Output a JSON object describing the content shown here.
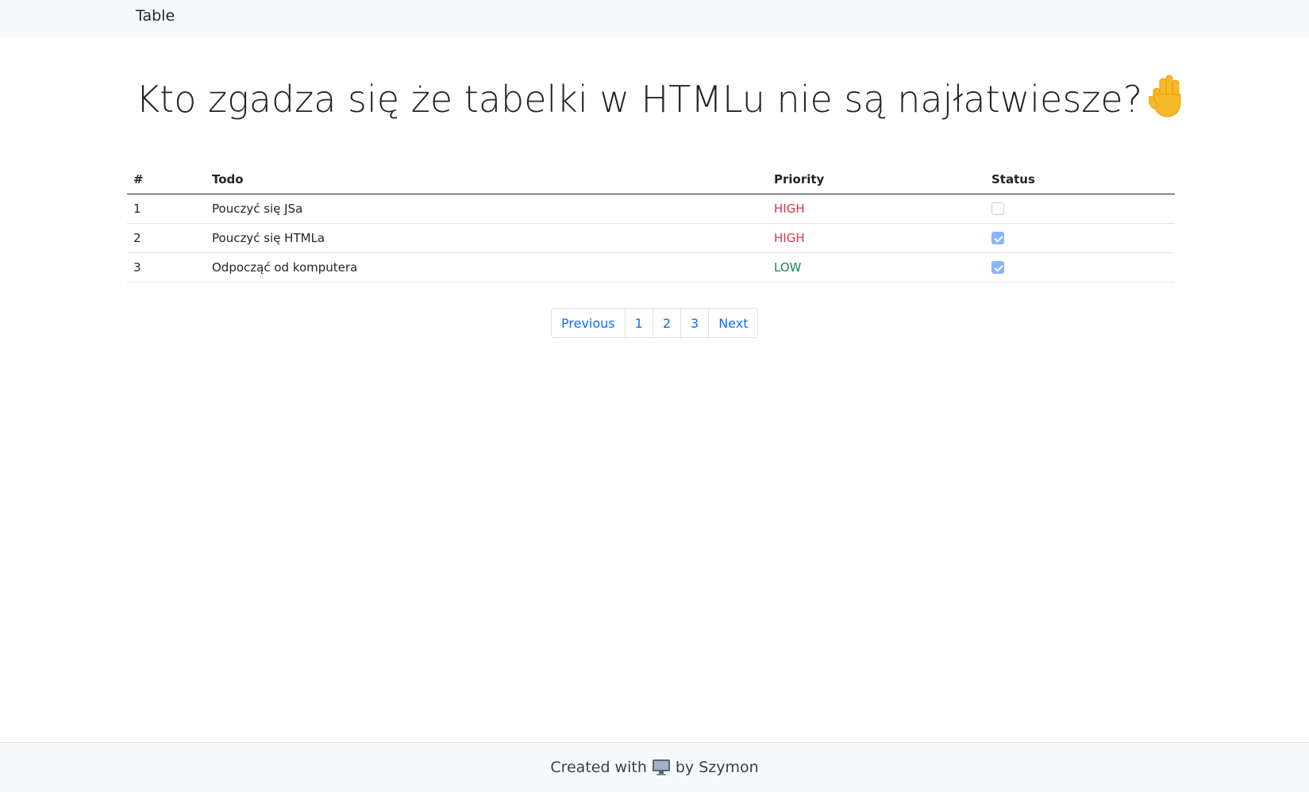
{
  "navbar": {
    "brand": "Table"
  },
  "main": {
    "title": "Kto zgadza się że tabelki w HTMLu nie są najłatwiesze?",
    "title_icon": "raised-hand-icon"
  },
  "table": {
    "headers": {
      "num": "#",
      "todo": "Todo",
      "priority": "Priority",
      "status": "Status"
    },
    "rows": [
      {
        "num": "1",
        "todo": "Pouczyć się JSa",
        "priority": "HIGH",
        "priority_color": "#dc3545",
        "done": false
      },
      {
        "num": "2",
        "todo": "Pouczyć się HTMLa",
        "priority": "HIGH",
        "priority_color": "#dc3545",
        "done": true
      },
      {
        "num": "3",
        "todo": "Odpocząć od komputera",
        "priority": "LOW",
        "priority_color": "#198754",
        "done": true
      }
    ]
  },
  "pagination": {
    "previous": "Previous",
    "pages": [
      "1",
      "2",
      "3"
    ],
    "next": "Next",
    "link_color": "#0d6efd"
  },
  "footer": {
    "prefix": "Created with",
    "icon": "computer-icon",
    "suffix": "by Szymon"
  }
}
